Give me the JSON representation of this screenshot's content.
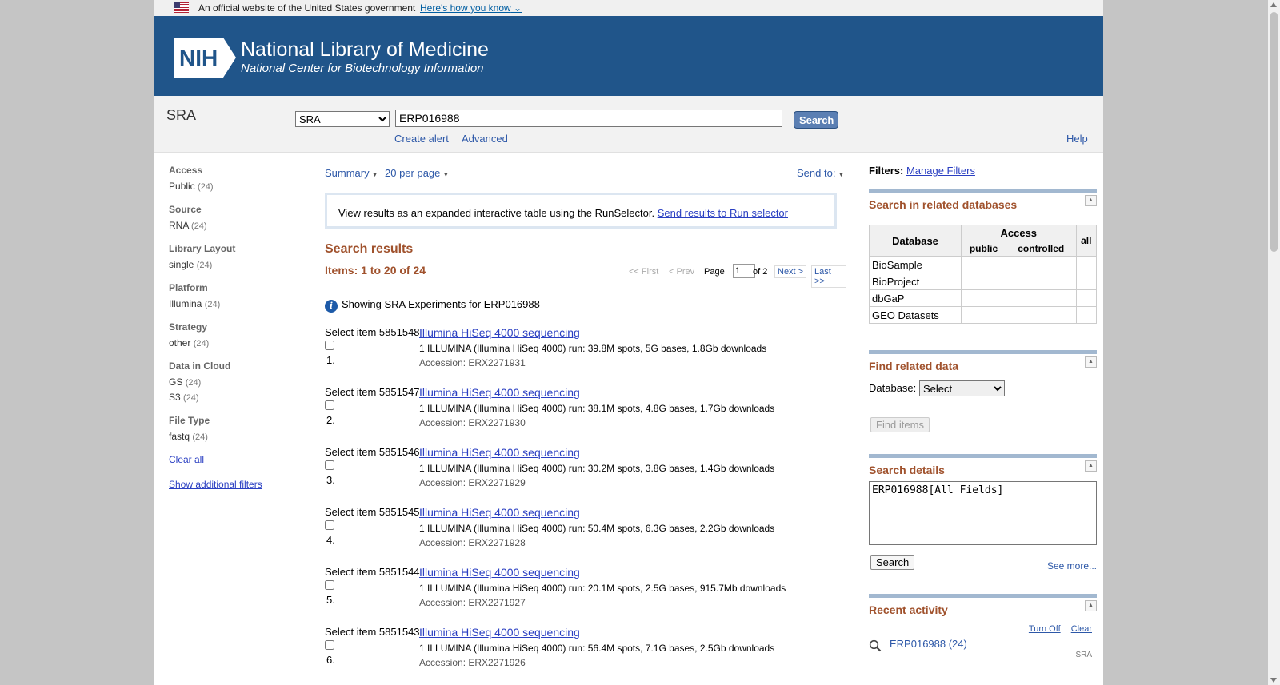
{
  "gov_banner": {
    "text": "An official website of the United States government",
    "link": "Here's how you know"
  },
  "masthead": {
    "logo": "NIH",
    "title": "National Library of Medicine",
    "subtitle": "National Center for Biotechnology Information"
  },
  "search": {
    "db_label": "SRA",
    "db_selected": "SRA",
    "term": "ERP016988",
    "button": "Search",
    "create_alert": "Create alert",
    "advanced": "Advanced",
    "help": "Help"
  },
  "filters": {
    "groups": [
      {
        "title": "Access",
        "items": [
          {
            "label": "Public",
            "count": "(24)"
          }
        ]
      },
      {
        "title": "Source",
        "items": [
          {
            "label": "RNA",
            "count": "(24)"
          }
        ]
      },
      {
        "title": "Library Layout",
        "items": [
          {
            "label": "single",
            "count": "(24)"
          }
        ]
      },
      {
        "title": "Platform",
        "items": [
          {
            "label": "Illumina",
            "count": "(24)"
          }
        ]
      },
      {
        "title": "Strategy",
        "items": [
          {
            "label": "other",
            "count": "(24)"
          }
        ]
      },
      {
        "title": "Data in Cloud",
        "items": [
          {
            "label": "GS",
            "count": "(24)"
          },
          {
            "label": "S3",
            "count": "(24)"
          }
        ]
      },
      {
        "title": "File Type",
        "items": [
          {
            "label": "fastq",
            "count": "(24)"
          }
        ]
      }
    ],
    "clear_all": "Clear all",
    "show_additional": "Show additional filters"
  },
  "display": {
    "format": "Summary",
    "per_page": "20 per page",
    "send_to": "Send to:"
  },
  "runselector": {
    "text": "View results as an expanded interactive table using the RunSelector.",
    "link": "Send results to Run selector"
  },
  "results": {
    "title": "Search results",
    "items_label": "Items: 1 to 20 of 24",
    "pager": {
      "first": "<< First",
      "prev": "< Prev",
      "page_label": "Page",
      "page_value": "1",
      "of": "of 2",
      "next": "Next >",
      "last": "Last >>"
    },
    "showing": "Showing SRA Experiments for ERP016988",
    "items": [
      {
        "select": "Select item 5851548",
        "num": "1.",
        "title": "Illumina HiSeq 4000 sequencing",
        "desc": "1 ILLUMINA (Illumina HiSeq 4000) run: 39.8M spots, 5G bases, 1.8Gb downloads",
        "accession": "Accession: ERX2271931"
      },
      {
        "select": "Select item 5851547",
        "num": "2.",
        "title": "Illumina HiSeq 4000 sequencing",
        "desc": "1 ILLUMINA (Illumina HiSeq 4000) run: 38.1M spots, 4.8G bases, 1.7Gb downloads",
        "accession": "Accession: ERX2271930"
      },
      {
        "select": "Select item 5851546",
        "num": "3.",
        "title": "Illumina HiSeq 4000 sequencing",
        "desc": "1 ILLUMINA (Illumina HiSeq 4000) run: 30.2M spots, 3.8G bases, 1.4Gb downloads",
        "accession": "Accession: ERX2271929"
      },
      {
        "select": "Select item 5851545",
        "num": "4.",
        "title": "Illumina HiSeq 4000 sequencing",
        "desc": "1 ILLUMINA (Illumina HiSeq 4000) run: 50.4M spots, 6.3G bases, 2.2Gb downloads",
        "accession": "Accession: ERX2271928"
      },
      {
        "select": "Select item 5851544",
        "num": "5.",
        "title": "Illumina HiSeq 4000 sequencing",
        "desc": "1 ILLUMINA (Illumina HiSeq 4000) run: 20.1M spots, 2.5G bases, 915.7Mb downloads",
        "accession": "Accession: ERX2271927"
      },
      {
        "select": "Select item 5851543",
        "num": "6.",
        "title": "Illumina HiSeq 4000 sequencing",
        "desc": "1 ILLUMINA (Illumina HiSeq 4000) run: 56.4M spots, 7.1G bases, 2.5Gb downloads",
        "accession": "Accession: ERX2271926"
      }
    ]
  },
  "right": {
    "filters_label": "Filters:",
    "manage_filters": "Manage Filters",
    "related": {
      "title": "Search in related databases",
      "col_database": "Database",
      "col_access": "Access",
      "col_all": "all",
      "col_public": "public",
      "col_controlled": "controlled",
      "rows": [
        "BioSample",
        "BioProject",
        "dbGaP",
        "GEO Datasets"
      ]
    },
    "find_related": {
      "title": "Find related data",
      "db_label": "Database:",
      "db_selected": "Select",
      "button": "Find items"
    },
    "details": {
      "title": "Search details",
      "query": "ERP016988[All Fields]",
      "button": "Search",
      "see_more": "See more..."
    },
    "recent": {
      "title": "Recent activity",
      "turn_off": "Turn Off",
      "clear": "Clear",
      "item": "ERP016988 (24)",
      "item_db": "SRA"
    }
  },
  "colors": {
    "masthead": "#20558a",
    "section_title": "#a0522d",
    "link": "#2a3fc2"
  }
}
